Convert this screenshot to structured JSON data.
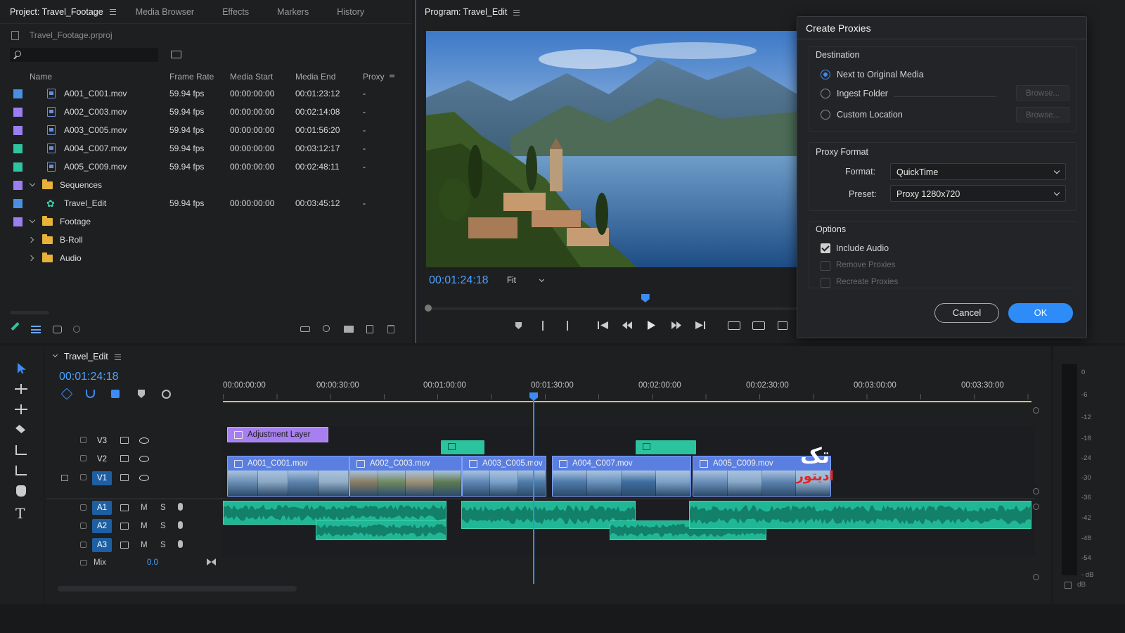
{
  "project_panel": {
    "tabs": [
      "Project: Travel_Footage",
      "Media Browser",
      "Effects",
      "Markers",
      "History"
    ],
    "project_file": "Travel_Footage.prproj",
    "search_placeholder": "",
    "columns": [
      "Name",
      "Frame Rate",
      "Media Start",
      "Media End",
      "Proxy"
    ],
    "items": [
      {
        "name": "A001_C001.mov",
        "rate": "59.94 fps",
        "start": "00:00:00:00",
        "end": "00:01:23:12",
        "proxy": "-",
        "color": "#4a90e2",
        "kind": "clip"
      },
      {
        "name": "A002_C003.mov",
        "rate": "59.94 fps",
        "start": "00:00:00:00",
        "end": "00:02:14:08",
        "proxy": "-",
        "color": "#9b7ff0",
        "kind": "clip"
      },
      {
        "name": "A003_C005.mov",
        "rate": "59.94 fps",
        "start": "00:00:00:00",
        "end": "00:01:56:20",
        "proxy": "-",
        "color": "#9b7ff0",
        "kind": "clip"
      },
      {
        "name": "A004_C007.mov",
        "rate": "59.94 fps",
        "start": "00:00:00:00",
        "end": "00:03:12:17",
        "proxy": "-",
        "color": "#2ec4a0",
        "kind": "clip"
      },
      {
        "name": "A005_C009.mov",
        "rate": "59.94 fps",
        "start": "00:00:00:00",
        "end": "00:02:48:11",
        "proxy": "-",
        "color": "#2ec4a0",
        "kind": "clip"
      },
      {
        "name": "Sequences",
        "color": "#9b7ff0",
        "kind": "folder-open"
      },
      {
        "name": "Travel_Edit",
        "rate": "59.94 fps",
        "start": "00:00:00:00",
        "end": "00:03:45:12",
        "proxy": "-",
        "color": "#4a90e2",
        "kind": "sequence"
      },
      {
        "name": "Footage",
        "color": "#9b7ff0",
        "kind": "folder-open"
      },
      {
        "name": "B-Roll",
        "kind": "folder-closed"
      },
      {
        "name": "Audio",
        "kind": "folder-closed"
      }
    ]
  },
  "program_monitor": {
    "title": "Program: Travel_Edit",
    "timecode": "00:01:24:18",
    "zoom": "Fit",
    "playhead_fraction": 0.59
  },
  "create_proxies": {
    "title": "Create Proxies",
    "destination": {
      "label": "Destination",
      "options": [
        "Next to Original Media",
        "Ingest Folder",
        "Custom Location"
      ],
      "selected": 0,
      "browse_label": "Browse..."
    },
    "proxy_format": {
      "label": "Proxy Format",
      "format_label": "Format:",
      "format_value": "QuickTime",
      "preset_label": "Preset:",
      "preset_value": "Proxy 1280x720"
    },
    "options": {
      "label": "Options",
      "include_audio": "Include Audio",
      "remove_proxies": "Remove Proxies",
      "recreate_proxies": "Recreate Proxies"
    },
    "cancel_label": "Cancel",
    "ok_label": "OK"
  },
  "timeline": {
    "sequence_name": "Travel_Edit",
    "timecode": "00:01:24:18",
    "ruler": [
      "00:00:00:00",
      "00:00:30:00",
      "00:01:00:00",
      "00:01:30:00",
      "00:02:00:00",
      "00:02:30:00",
      "00:03:00:00",
      "00:03:30:00"
    ],
    "video_tracks": [
      "V3",
      "V2",
      "V1"
    ],
    "audio_tracks": [
      "A1",
      "A2",
      "A3"
    ],
    "mute_label": "M",
    "solo_label": "S",
    "mix_label": "Mix",
    "mix_value": "0.0",
    "adjustment_layer": "Adjustment Layer",
    "clips": [
      "A001_C001.mov",
      "A002_C003.mov",
      "A003_C005.mov",
      "A004_C007.mov",
      "A005_C009.mov"
    ]
  },
  "audio_meter": {
    "scale": [
      "0",
      "-6",
      "-12",
      "-18",
      "-24",
      "-30",
      "-36",
      "-42",
      "-48",
      "-54",
      "- dB"
    ],
    "footer": "dB"
  },
  "watermark": {
    "line1": "تک",
    "line2": "ادیتور"
  },
  "colors": {
    "accent": "#3b8cf5",
    "timecode": "#4aa3ff",
    "audio_clip": "#20b796",
    "video_clip": "#5b7fe0",
    "adjustment": "#a77ff0"
  }
}
